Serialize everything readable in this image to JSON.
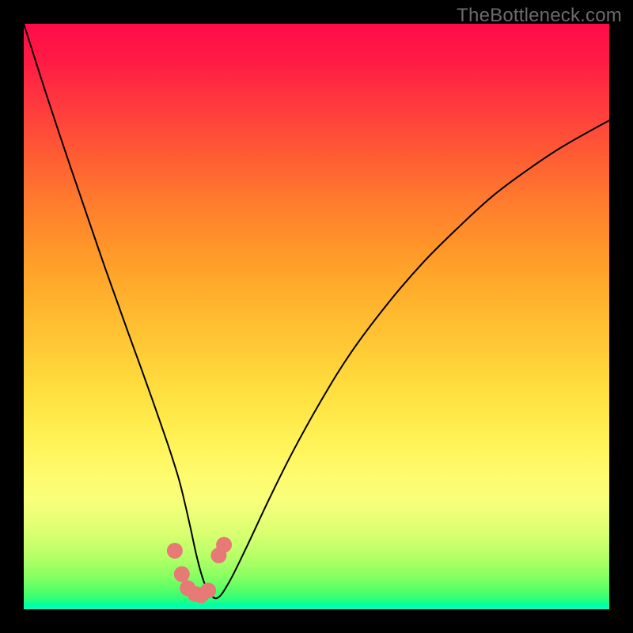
{
  "watermark": "TheBottleneck.com",
  "chart_data": {
    "type": "line",
    "title": "",
    "xlabel": "",
    "ylabel": "",
    "xlim": [
      0,
      100
    ],
    "ylim": [
      0,
      100
    ],
    "grid": false,
    "series": [
      {
        "name": "bottleneck-curve",
        "x": [
          0,
          4,
          8,
          12,
          14,
          16,
          18,
          20,
          22,
          23.5,
          25,
          26.5,
          27.5,
          28.5,
          29.5,
          30.5,
          31.5,
          33,
          35,
          38,
          42,
          46,
          51,
          56,
          62,
          68,
          74,
          80,
          86,
          92,
          100
        ],
        "y": [
          100,
          87.5,
          75.5,
          63.8,
          58,
          52.4,
          46.8,
          41.3,
          35.7,
          31.4,
          27,
          22.2,
          18.2,
          13.8,
          9.2,
          5.5,
          3.2,
          1.9,
          4.5,
          10.5,
          19,
          27,
          36,
          44,
          52,
          59,
          65,
          70.5,
          75,
          79,
          83.5
        ]
      }
    ],
    "markers": {
      "name": "highlight-dots",
      "color": "#e77a77",
      "points": [
        {
          "x": 25.8,
          "y": 10.0,
          "r": 1.35
        },
        {
          "x": 27.0,
          "y": 6.0,
          "r": 1.35
        },
        {
          "x": 28.0,
          "y": 3.6,
          "r": 1.35
        },
        {
          "x": 29.3,
          "y": 2.6,
          "r": 1.35
        },
        {
          "x": 30.3,
          "y": 2.4,
          "r": 1.35
        },
        {
          "x": 31.5,
          "y": 3.2,
          "r": 1.35
        },
        {
          "x": 33.3,
          "y": 9.2,
          "r": 1.35
        },
        {
          "x": 34.2,
          "y": 11.0,
          "r": 1.35
        }
      ]
    }
  }
}
